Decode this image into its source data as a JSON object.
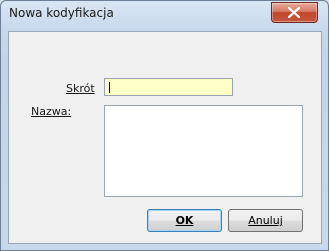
{
  "window": {
    "title": "Nowa kodyfikacja",
    "close_icon": "close-icon"
  },
  "form": {
    "skrot_label": "Skrót",
    "skrot_value": "",
    "nazwa_label": "Nazwa:",
    "nazwa_value": ""
  },
  "buttons": {
    "ok_label": "OK",
    "cancel_label": "Anuluj"
  },
  "colors": {
    "input_highlight": "#ffffc8",
    "close_button": "#c1432a",
    "default_button_border": "#3c7fb1"
  }
}
